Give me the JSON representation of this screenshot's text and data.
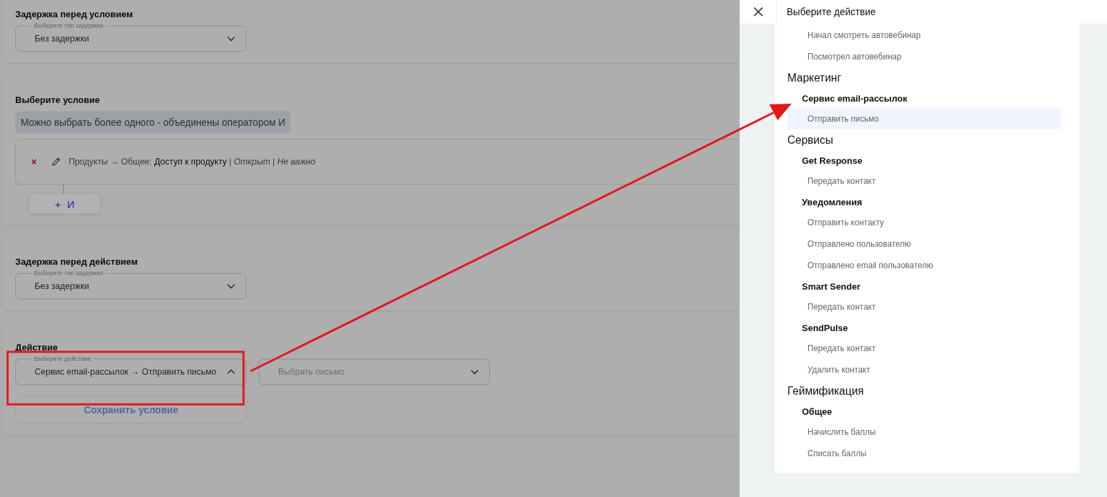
{
  "sections": [
    {
      "kind": "delay",
      "title": "Задержка перед условием",
      "select": {
        "label": "Выберите тип задержки",
        "value": "Без задержки",
        "open": false
      }
    },
    {
      "kind": "condition",
      "title": "Выберите условие",
      "hint": "Можно выбрать более одного - объединены оператором И",
      "conditions": [
        {
          "remove": "×",
          "text": "Продукты → Общее: **Доступ к продукту** | *Открыт* | *Не важно*"
        }
      ],
      "add_button": {
        "plus": "+",
        "label": "И"
      }
    },
    {
      "kind": "delay",
      "title": "Задержка перед действием",
      "select": {
        "label": "Выберите тип задержки",
        "value": "Без задержки",
        "open": false
      }
    },
    {
      "kind": "action",
      "title": "Действие",
      "select": {
        "label": "Выберите действие",
        "value": "Сервис email-рассылок → Отправить письмо",
        "open": true
      },
      "letter_select": {
        "placeholder": "Выбрать письмо",
        "open": false
      },
      "save_button": {
        "label": "Сохранить условие",
        "disabled": true
      }
    }
  ],
  "drawer": {
    "title": "Выберите действие",
    "groups": [
      {
        "subgroups": [
          {
            "items": [
              {
                "label": "Начал смотреть автовебинар",
                "selected": false
              },
              {
                "label": "Посмотрел автовебинар",
                "selected": false
              }
            ]
          }
        ]
      },
      {
        "title": "Маркетинг",
        "subgroups": [
          {
            "title": "Сервис email-рассылок",
            "items": [
              {
                "label": "Отправить письмо",
                "selected": true
              }
            ]
          }
        ]
      },
      {
        "title": "Сервисы",
        "subgroups": [
          {
            "title": "Get Response",
            "items": [
              {
                "label": "Передать контакт",
                "selected": false
              }
            ]
          },
          {
            "title": "Уведомления",
            "items": [
              {
                "label": "Отправить контакту",
                "selected": false
              },
              {
                "label": "Отправлено пользователю",
                "selected": false
              },
              {
                "label": "Отправлено email пользователю",
                "selected": false
              }
            ]
          },
          {
            "title": "Smart Sender",
            "items": [
              {
                "label": "Передать контакт",
                "selected": false
              }
            ]
          },
          {
            "title": "SendPulse",
            "items": [
              {
                "label": "Передать контакт",
                "selected": false
              },
              {
                "label": "Удалить контакт",
                "selected": false
              }
            ]
          }
        ]
      },
      {
        "title": "Геймификация",
        "subgroups": [
          {
            "title": "Общее",
            "items": [
              {
                "label": "Начислить баллы",
                "selected": false
              },
              {
                "label": "Списать баллы",
                "selected": false
              }
            ]
          }
        ]
      }
    ]
  }
}
